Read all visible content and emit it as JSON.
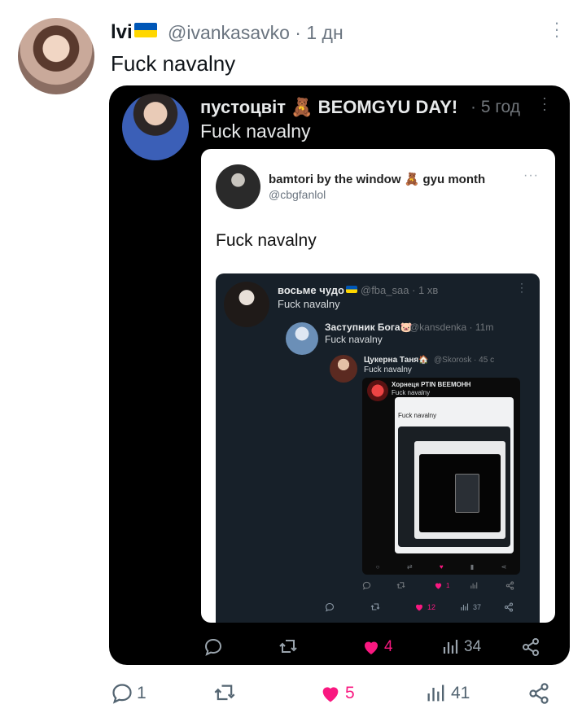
{
  "outer": {
    "name": "lvi",
    "handle": "@ivankasavko · 1 дн",
    "text": "Fuck navalny",
    "actions": {
      "reply": "1",
      "retweet": "",
      "like": "5",
      "views": "41"
    }
  },
  "card1": {
    "name": "пустоцвіт 🧸 BEOMGYU DAY!",
    "time": "· 5 год",
    "text": "Fuck navalny",
    "actions": {
      "like": "4",
      "views": "34"
    }
  },
  "card2": {
    "name": "bamtori by the window 🧸 gyu month",
    "handle": "@cbgfanlol",
    "text": "Fuck navalny"
  },
  "card3": {
    "name": "восьме чудо",
    "time": "@fba_saa · 1 хв",
    "text": "Fuck navalny",
    "actions": {
      "like": "12",
      "views": "37"
    }
  },
  "card4": {
    "name": "Заступник Бога🐷",
    "time": "@kansdenka · 11m",
    "text": "Fuck navalny",
    "actions": {
      "like": "1"
    }
  },
  "card5": {
    "name": "Цукерна Таня🏠",
    "time": "@Skorosk · 45 с",
    "text": "Fuck navalny"
  },
  "card6": {
    "name": "Хорнеця PTIN ВЕЕМОНН",
    "text": "Fuck navalny"
  },
  "card7": {
    "text": "Fuck navalny"
  },
  "icons": {
    "reply": "reply-icon",
    "retweet": "retweet-icon",
    "like": "heart-icon",
    "views": "views-icon",
    "share": "share-icon",
    "more": "more-icon"
  },
  "colors": {
    "like": "#f91880",
    "muted": "#536471",
    "dark_card": "#000000",
    "navy_card": "#172029"
  }
}
